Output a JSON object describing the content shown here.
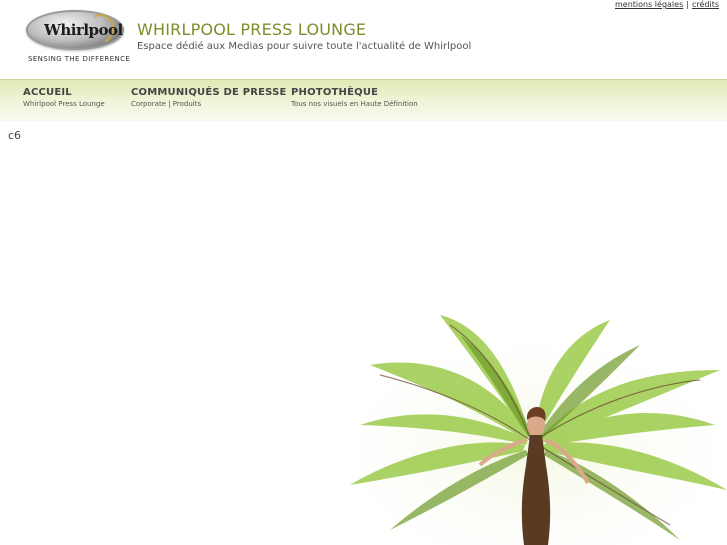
{
  "top_links": {
    "legal": "mentions légales",
    "separator": "|",
    "credits": "crédits"
  },
  "logo": {
    "word": "Whirlpool",
    "tagline": "SENSING THE DIFFERENCE"
  },
  "header": {
    "title": "WHIRLPOOL PRESS LOUNGE",
    "subtitle": "Espace dédié aux Medias pour suivre toute l'actualité de Whirlpool"
  },
  "nav": [
    {
      "label": "ACCUEIL",
      "desc": "Whirlpool Press Lounge"
    },
    {
      "label": "COMMUNIQUÉS DE PRESSE",
      "desc": "Corporate | Produits"
    },
    {
      "label": "PHOTOTHÈQUE",
      "desc": "Tous nos visuels en Haute Définition"
    }
  ],
  "content": {
    "text": "c6"
  },
  "colors": {
    "accent_green": "#7a8f2a",
    "nav_gradient_top": "#dfe8b5",
    "leaf_green": "#8fbf3a"
  }
}
